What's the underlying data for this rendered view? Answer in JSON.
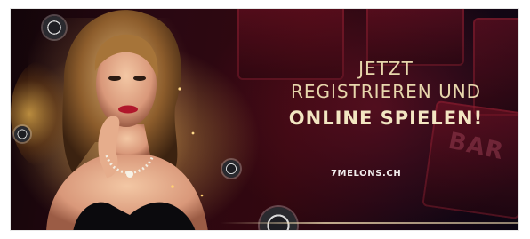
{
  "banner": {
    "headline_line1": "JETZT",
    "headline_line2": "REGISTRIEREN UND",
    "headline_line3": "ONLINE SPIELEN!",
    "website": "7MELONS.CH",
    "slot_label": "BAR"
  },
  "colors": {
    "background_dark": "#1a0714",
    "background_red": "#32070f",
    "headline_gold": "#e7d6ac",
    "website_text": "#f1ecec",
    "lips": "#b0172b",
    "dress": "#0b0a0d"
  },
  "icons": [
    "casino-chip-icon",
    "casino-chip-icon",
    "casino-chip-icon",
    "casino-chip-icon"
  ]
}
